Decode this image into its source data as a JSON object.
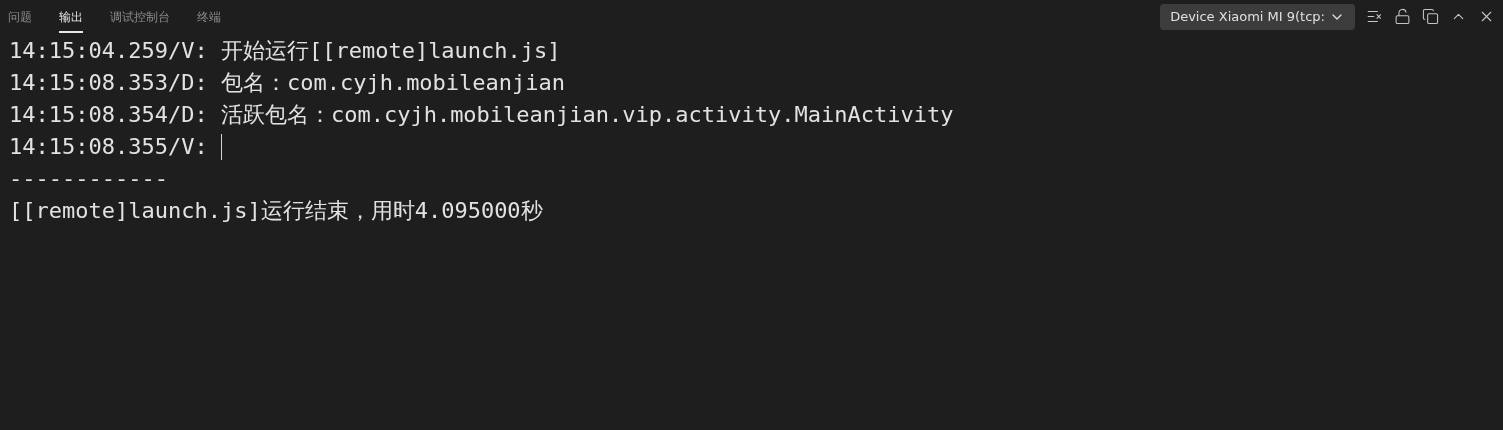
{
  "tabs": [
    {
      "label": "问题",
      "selected": false
    },
    {
      "label": "输出",
      "selected": true
    },
    {
      "label": "调试控制台",
      "selected": false
    },
    {
      "label": "终端",
      "selected": false
    }
  ],
  "device_select": {
    "value": "Device Xiaomi MI 9(tcp:"
  },
  "output_lines": [
    {
      "text": "14:15:04.259/V: 开始运行[[remote]launch.js]",
      "cursor": false
    },
    {
      "text": "14:15:08.353/D: 包名：com.cyjh.mobileanjian",
      "cursor": false
    },
    {
      "text": "14:15:08.354/D: 活跃包名：com.cyjh.mobileanjian.vip.activity.MainActivity",
      "cursor": false
    },
    {
      "text": "14:15:08.355/V: ",
      "cursor": true
    },
    {
      "text": "------------",
      "cursor": false
    },
    {
      "text": "[[remote]launch.js]运行结束，用时4.095000秒",
      "cursor": false
    }
  ]
}
